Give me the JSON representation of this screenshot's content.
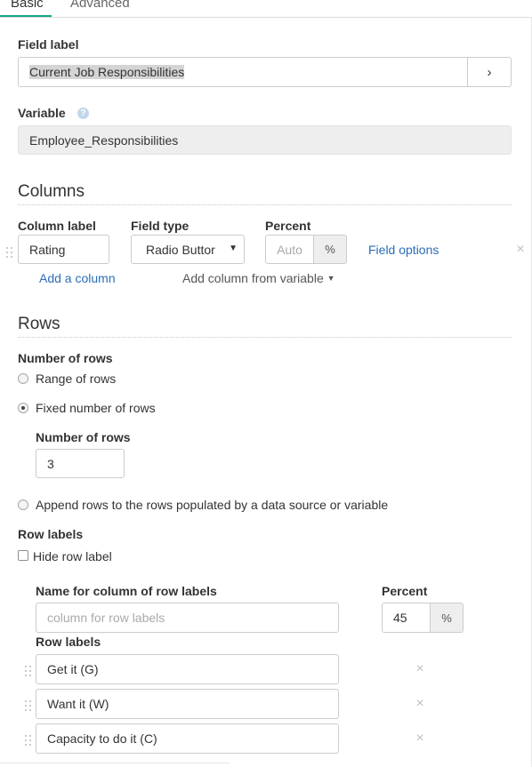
{
  "tabs": {
    "basic": "Basic",
    "advanced": "Advanced"
  },
  "field_label": {
    "label": "Field label",
    "value": "Current Job Responsibilities",
    "open_button": "›"
  },
  "variable": {
    "label": "Variable",
    "info_icon": "?",
    "value": "Employee_Responsibilities"
  },
  "columns": {
    "heading": "Columns",
    "column_label_header": "Column label",
    "field_type_header": "Field type",
    "percent_header": "Percent",
    "row": {
      "label": "Rating",
      "field_type": "Radio Buttor",
      "percent_placeholder": "Auto",
      "percent_addon": "%",
      "field_options": "Field options",
      "remove": "×"
    },
    "add_column": "Add a column",
    "add_from_variable": "Add column from variable"
  },
  "rows": {
    "heading": "Rows",
    "number_of_rows_label": "Number of rows",
    "options": {
      "range": "Range of rows",
      "fixed": "Fixed number of rows",
      "append": "Append rows to the rows populated by a data source or variable"
    },
    "selected_option": "fixed",
    "fixed_count_label": "Number of rows",
    "fixed_count_value": "3",
    "row_labels_heading": "Row labels",
    "hide_row_label": "Hide row label",
    "name_for_column_label": "Name for column of row labels",
    "name_for_column_placeholder": "column for row labels",
    "percent_label": "Percent",
    "percent_value": "45",
    "percent_addon": "%",
    "row_labels_label": "Row labels",
    "labels": [
      "Get it (G)",
      "Want it (W)",
      "Capacity to do it (C)"
    ],
    "remove": "×"
  }
}
